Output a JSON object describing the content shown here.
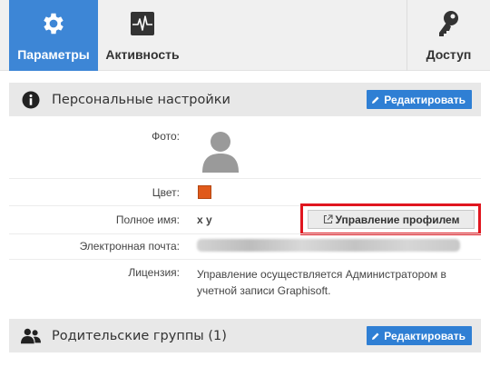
{
  "tabs": [
    {
      "label": "Параметры",
      "icon": "gear-icon",
      "active": true
    },
    {
      "label": "Активность",
      "icon": "activity-icon",
      "active": false
    },
    {
      "label": "Доступ",
      "icon": "key-icon",
      "active": false
    }
  ],
  "personal": {
    "title": "Персональные настройки",
    "icon": "info-icon",
    "edit_label": "Редактировать",
    "photo_label": "Фото:",
    "color_label": "Цвет:",
    "color_value": "#e05a1b",
    "fullname_label": "Полное имя:",
    "fullname_value": "x y",
    "manage_profile_label": "Управление профилем",
    "email_label": "Электронная почта:",
    "license_label": "Лицензия:",
    "license_value": "Управление осуществляется Администратором в учетной записи Graphisoft."
  },
  "parent_groups": {
    "title": "Родительские группы (1)",
    "icon": "users-icon",
    "edit_label": "Редактировать"
  }
}
